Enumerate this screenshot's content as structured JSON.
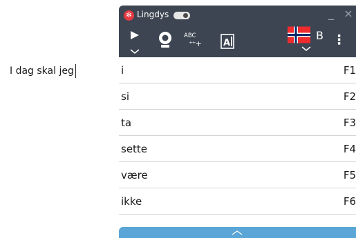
{
  "document": {
    "text": "I dag skal jeg"
  },
  "app": {
    "title": "Lingdys",
    "logo_icon": "lingdys-logo-icon",
    "toggle_state": "on",
    "accent_color": "#e43a43",
    "toolbar_color": "#3c4551",
    "expand_bar_color": "#5aa6d6"
  },
  "window_controls": {
    "minimize_glyph": "_",
    "close_glyph": "×"
  },
  "toolbar": {
    "play_icon": "play-icon",
    "voice_icon": "voice-icon",
    "spell_label": "ABC",
    "spell_icon": "spell-sparkle-icon",
    "dictionary_icon": "dictionary-icon",
    "language_flag": "norway-flag-icon",
    "language_label": "B",
    "more_glyph": "⋮"
  },
  "predictions": [
    {
      "word": "i",
      "key": "F1"
    },
    {
      "word": "si",
      "key": "F2"
    },
    {
      "word": "ta",
      "key": "F3"
    },
    {
      "word": "sette",
      "key": "F4"
    },
    {
      "word": "være",
      "key": "F5"
    },
    {
      "word": "ikke",
      "key": "F6"
    }
  ]
}
